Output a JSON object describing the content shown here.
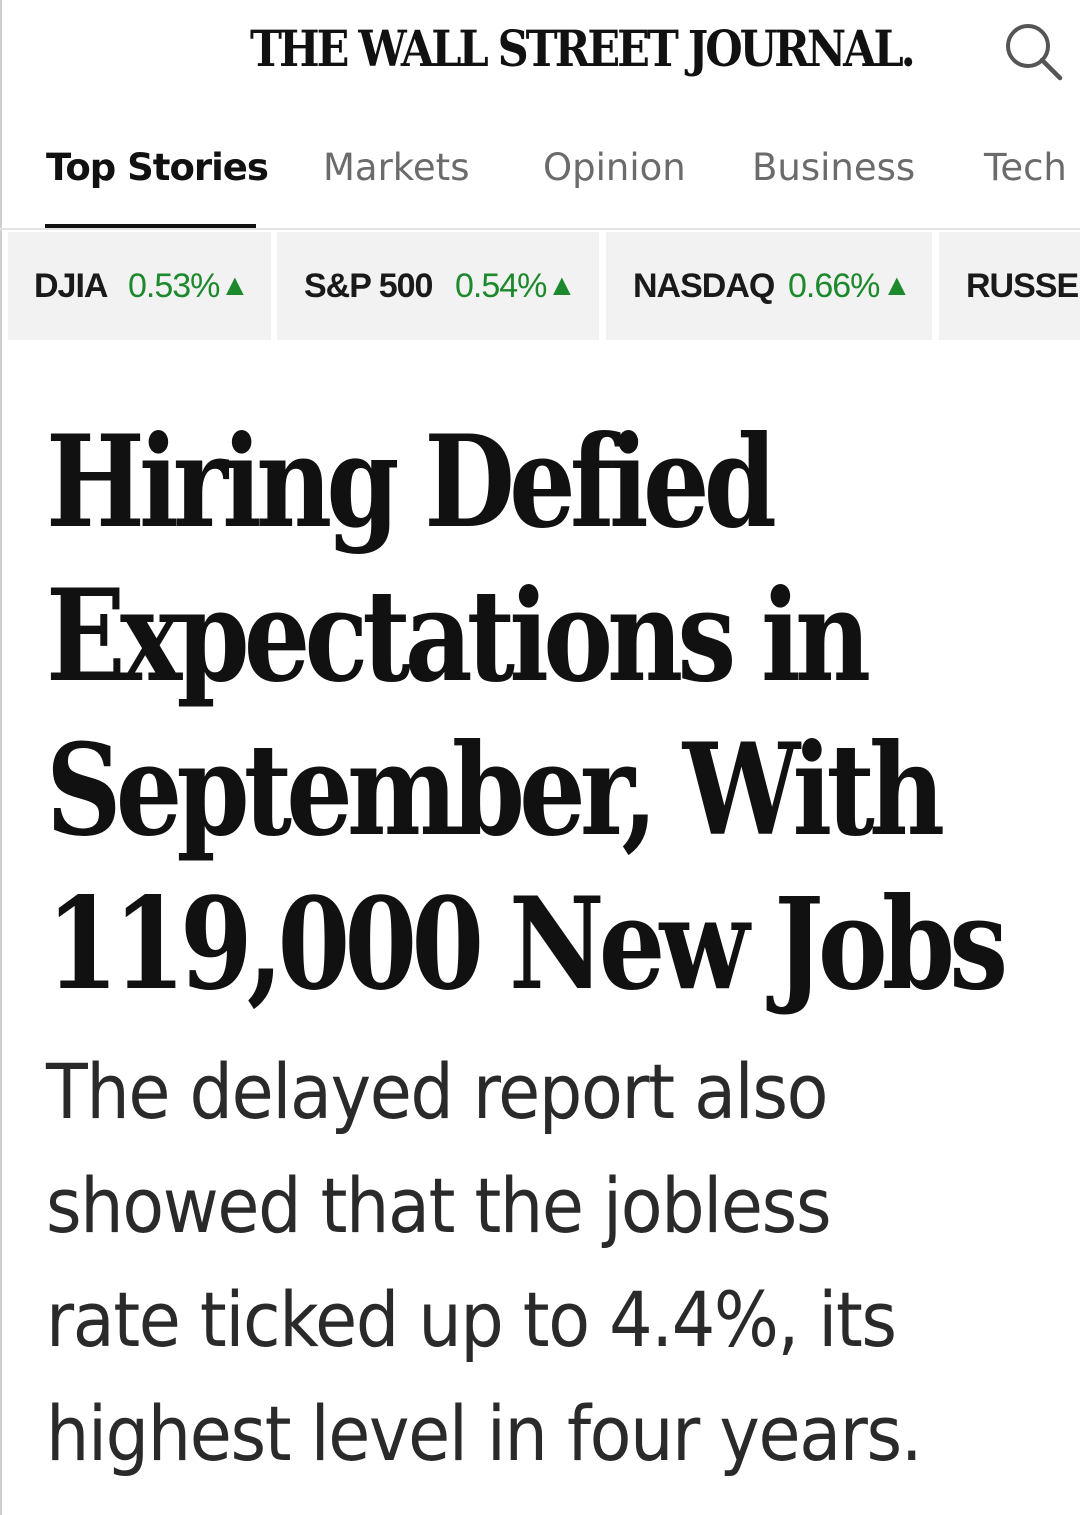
{
  "header": {
    "masthead": "THE WALL STREET JOURNAL."
  },
  "nav": {
    "tabs": [
      {
        "label": "Top Stories",
        "active": true
      },
      {
        "label": "Markets",
        "active": false
      },
      {
        "label": "Opinion",
        "active": false
      },
      {
        "label": "Business",
        "active": false
      },
      {
        "label": "Tech",
        "active": false
      }
    ]
  },
  "ticker": [
    {
      "name": "DJIA",
      "change": "0.53%",
      "direction": "up"
    },
    {
      "name": "S&P 500",
      "change": "0.54%",
      "direction": "up"
    },
    {
      "name": "NASDAQ",
      "change": "0.66%",
      "direction": "up"
    },
    {
      "name": "RUSSELL",
      "change": "",
      "direction": ""
    }
  ],
  "article": {
    "headline_lines": [
      "Hiring Defied",
      "Expectations in",
      "September, With",
      "119,000 New Jobs"
    ],
    "dek_lines": [
      "The delayed report also",
      "showed that the jobless",
      "rate ticked up to 4.4%, its",
      "highest level in four years."
    ]
  },
  "icons": {
    "search": "search-icon",
    "arrow_up": "▲"
  },
  "colors": {
    "positive": "#1c8a2c",
    "inactive_tab": "#6b6b6b",
    "ticker_bg": "#f2f2f2"
  }
}
